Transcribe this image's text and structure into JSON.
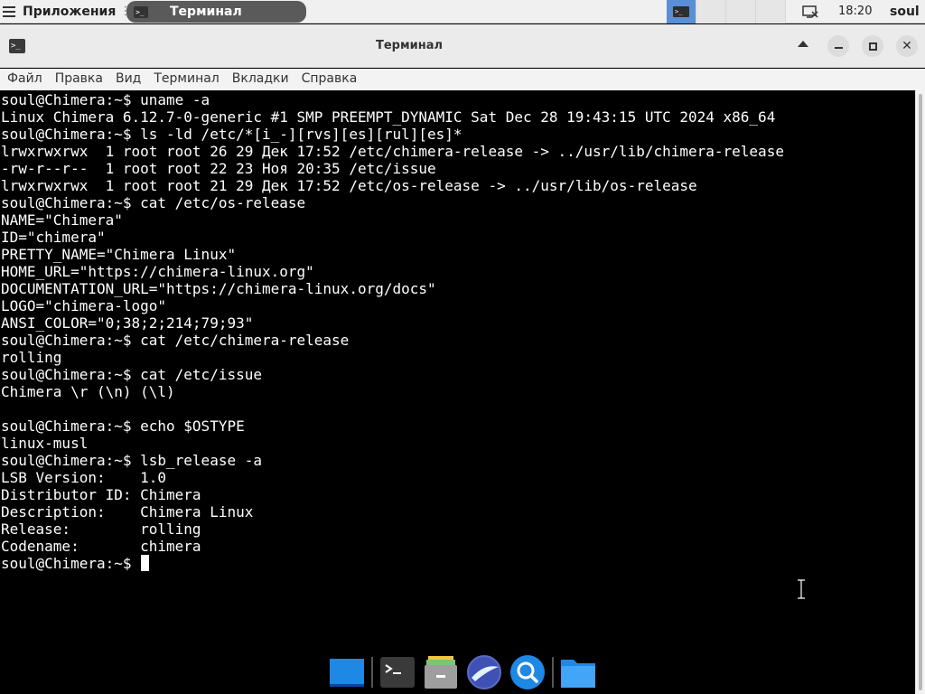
{
  "panel": {
    "apps_label": "Приложения",
    "task_label": "Терминал",
    "clock": "18:20",
    "user": "soul"
  },
  "window": {
    "title": "Терминал"
  },
  "menu": {
    "items": [
      "Файл",
      "Правка",
      "Вид",
      "Терминал",
      "Вкладки",
      "Справка"
    ]
  },
  "terminal": {
    "lines": [
      "soul@Chimera:~$ uname -a",
      "Linux Chimera 6.12.7-0-generic #1 SMP PREEMPT_DYNAMIC Sat Dec 28 19:43:15 UTC 2024 x86_64",
      "soul@Chimera:~$ ls -ld /etc/*[i_-][rvs][es][rul][es]*",
      "lrwxrwxrwx  1 root root 26 29 Дек 17:52 /etc/chimera-release -> ../usr/lib/chimera-release",
      "-rw-r--r--  1 root root 22 23 Ноя 20:35 /etc/issue",
      "lrwxrwxrwx  1 root root 21 29 Дек 17:52 /etc/os-release -> ../usr/lib/os-release",
      "soul@Chimera:~$ cat /etc/os-release",
      "NAME=\"Chimera\"",
      "ID=\"chimera\"",
      "PRETTY_NAME=\"Chimera Linux\"",
      "HOME_URL=\"https://chimera-linux.org\"",
      "DOCUMENTATION_URL=\"https://chimera-linux.org/docs\"",
      "LOGO=\"chimera-logo\"",
      "ANSI_COLOR=\"0;38;2;214;79;93\"",
      "soul@Chimera:~$ cat /etc/chimera-release",
      "rolling",
      "soul@Chimera:~$ cat /etc/issue",
      "Chimera \\r (\\n) (\\l)",
      "",
      "soul@Chimera:~$ echo $OSTYPE",
      "linux-musl",
      "soul@Chimera:~$ lsb_release -a",
      "LSB Version:    1.0",
      "Distributor ID: Chimera",
      "Description:    Chimera Linux",
      "Release:        rolling",
      "Codename:       chimera"
    ],
    "prompt": "soul@Chimera:~$ "
  },
  "dock": {
    "items": [
      {
        "icon": "desktop-icon",
        "color": "#1e88e5"
      },
      {
        "icon": "terminal-icon",
        "color": "#3a3a3a"
      },
      {
        "icon": "file-cabinet-icon",
        "color": "#9e9e9e"
      },
      {
        "icon": "web-browser-icon",
        "color": "#3f51b5"
      },
      {
        "icon": "search-icon",
        "color": "#1e88e5"
      },
      {
        "icon": "folder-icon",
        "color": "#42a5f5"
      }
    ]
  }
}
